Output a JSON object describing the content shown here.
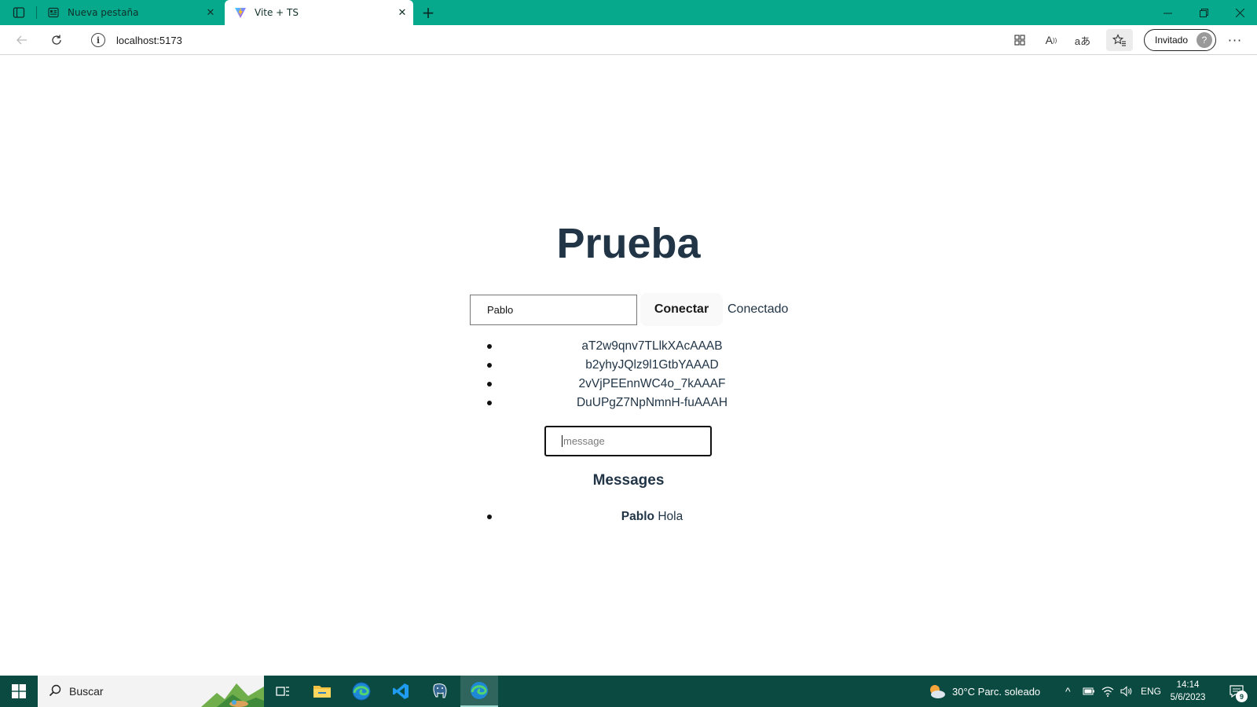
{
  "browser": {
    "tabs": [
      {
        "label": "Nueva pestaña",
        "icon": "new-tab-page-icon"
      },
      {
        "label": "Vite + TS",
        "icon": "vite-logo-icon"
      }
    ],
    "url": "localhost:5173",
    "profile_label": "Invitado",
    "accent_color": "#07a98d"
  },
  "page": {
    "title": "Prueba",
    "name_input_value": "Pablo",
    "connect_button": "Conectar",
    "status": "Conectado",
    "client_ids": [
      "aT2w9qnv7TLlkXAcAAAB",
      "b2yhyJQlz9l1GtbYAAAD",
      "2vVjPEEnnWC4o_7kAAAF",
      "DuUPgZ7NpNmnH-fuAAAH"
    ],
    "message_placeholder": "message",
    "messages_heading": "Messages",
    "messages": [
      {
        "author": "Pablo",
        "text": "Hola"
      }
    ],
    "text_color": "#213547"
  },
  "taskbar": {
    "search_placeholder": "Buscar",
    "weather": "30°C  Parc. soleado",
    "language": "ENG",
    "time": "14:14",
    "date": "5/6/2023",
    "notification_count": "9",
    "color": "#0b4a40"
  }
}
